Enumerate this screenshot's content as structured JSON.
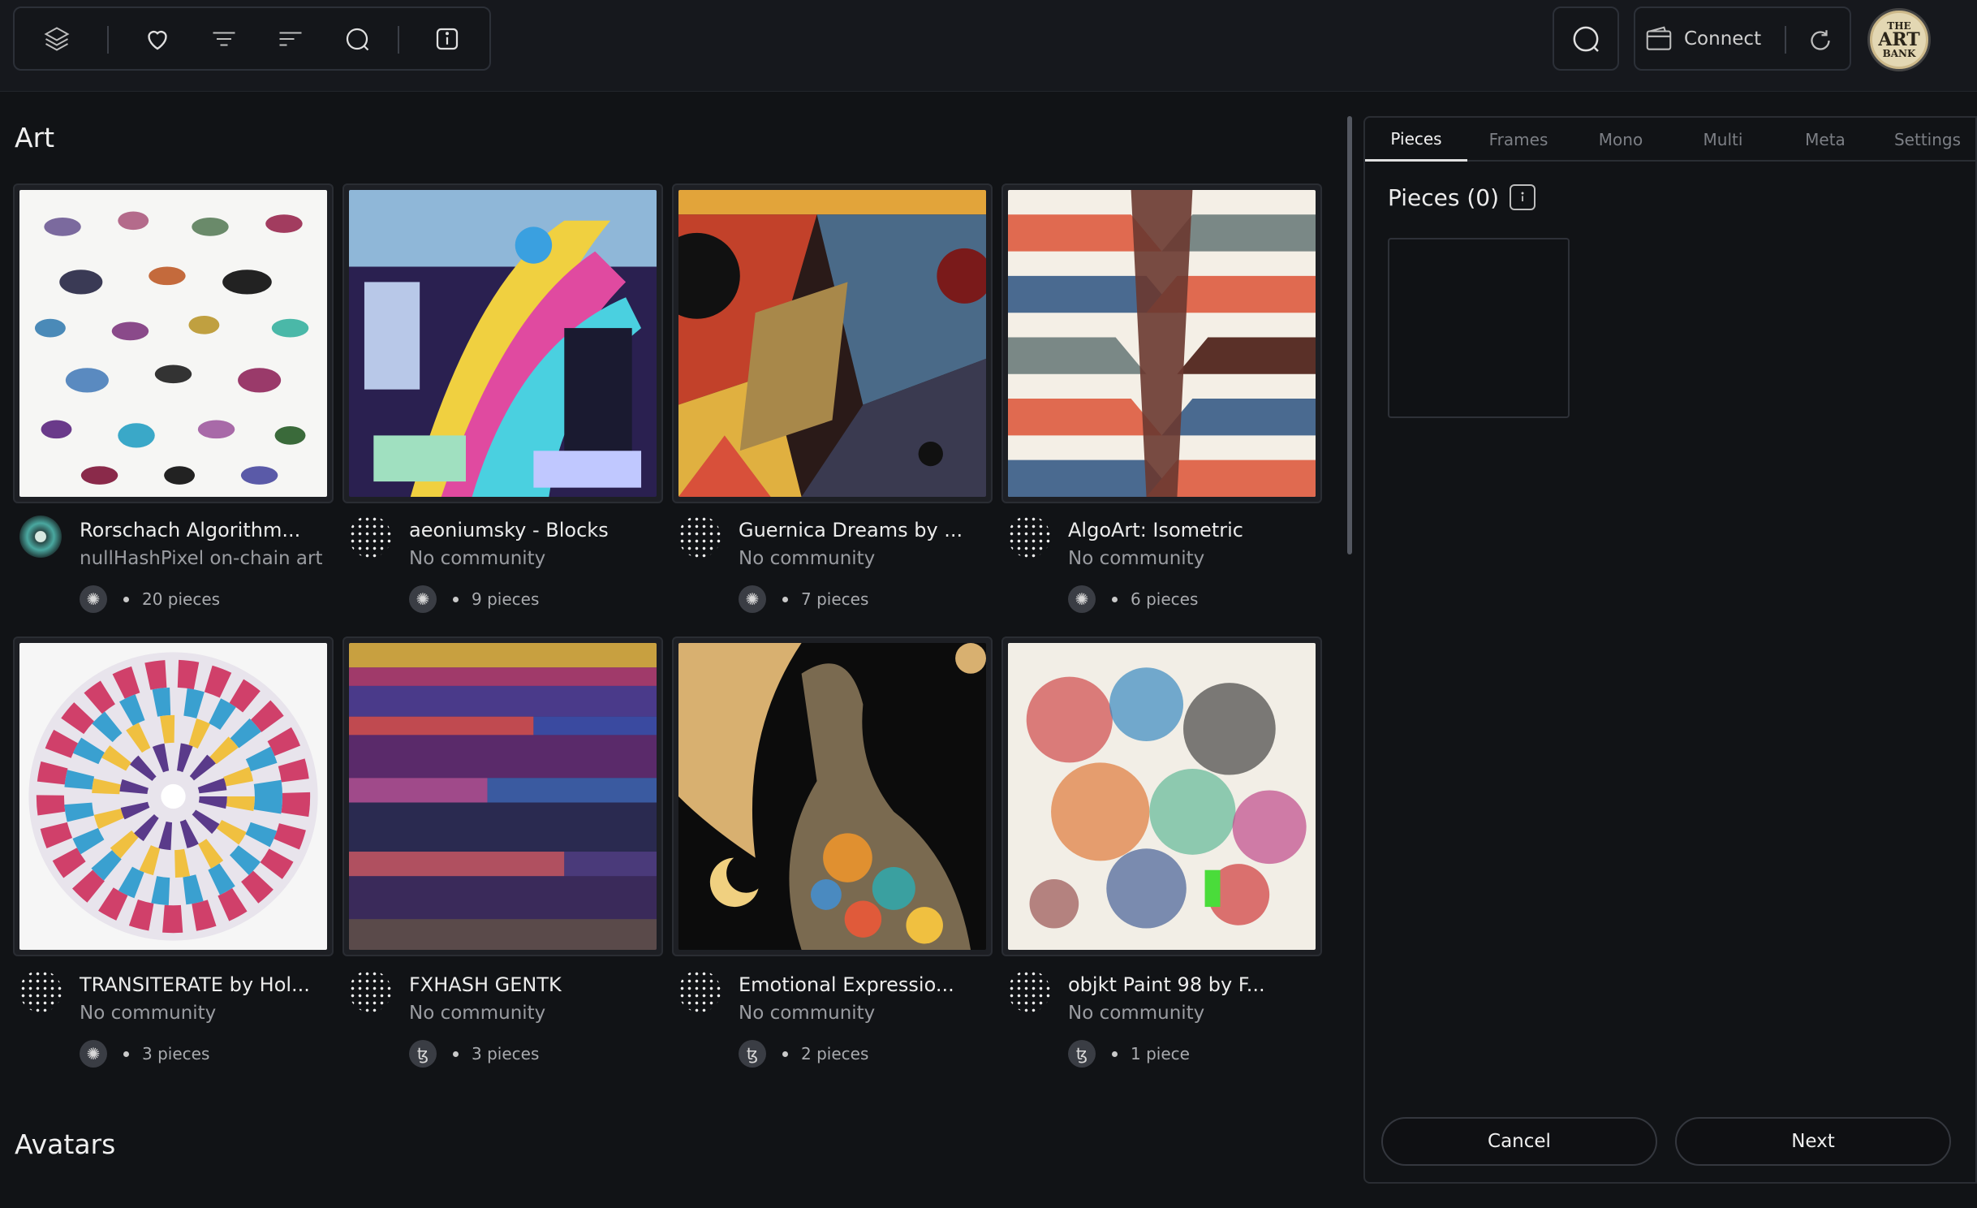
{
  "toolbar": {
    "icons": [
      "layers-icon",
      "heart-icon",
      "filter-icon",
      "sort-icon",
      "chat-icon",
      "info-icon"
    ],
    "connect_label": "Connect"
  },
  "logo": {
    "line1": "THE",
    "line2": "ART",
    "line3": "BANK"
  },
  "sections": {
    "art_title": "Art",
    "avatars_title": "Avatars"
  },
  "collections": [
    {
      "title": "Rorschach Algorithm...",
      "subtitle": "nullHashPixel on-chain art",
      "chain": "cardano",
      "count": "20 pieces"
    },
    {
      "title": "aeoniumsky - Blocks",
      "subtitle": "No community",
      "chain": "cardano",
      "count": "9 pieces"
    },
    {
      "title": "Guernica Dreams by ...",
      "subtitle": "No community",
      "chain": "cardano",
      "count": "7 pieces"
    },
    {
      "title": "AlgoArt: Isometric",
      "subtitle": "No community",
      "chain": "cardano",
      "count": "6 pieces"
    },
    {
      "title": "TRANSITERATE by Hol...",
      "subtitle": "No community",
      "chain": "cardano",
      "count": "3 pieces"
    },
    {
      "title": "FXHASH GENTK",
      "subtitle": "No community",
      "chain": "tezos",
      "count": "3 pieces"
    },
    {
      "title": "Emotional Expressio...",
      "subtitle": "No community",
      "chain": "tezos",
      "count": "2 pieces"
    },
    {
      "title": "objkt Paint 98 by F...",
      "subtitle": "No community",
      "chain": "tezos",
      "count": "1 piece"
    }
  ],
  "panel": {
    "tabs": [
      "Pieces",
      "Frames",
      "Mono",
      "Multi",
      "Meta",
      "Settings"
    ],
    "active_tab": "Pieces",
    "heading": "Pieces (0)",
    "cancel_label": "Cancel",
    "next_label": "Next"
  },
  "colors": {
    "background": "#111316",
    "topbar": "#16181d",
    "border": "#2a2d33"
  }
}
